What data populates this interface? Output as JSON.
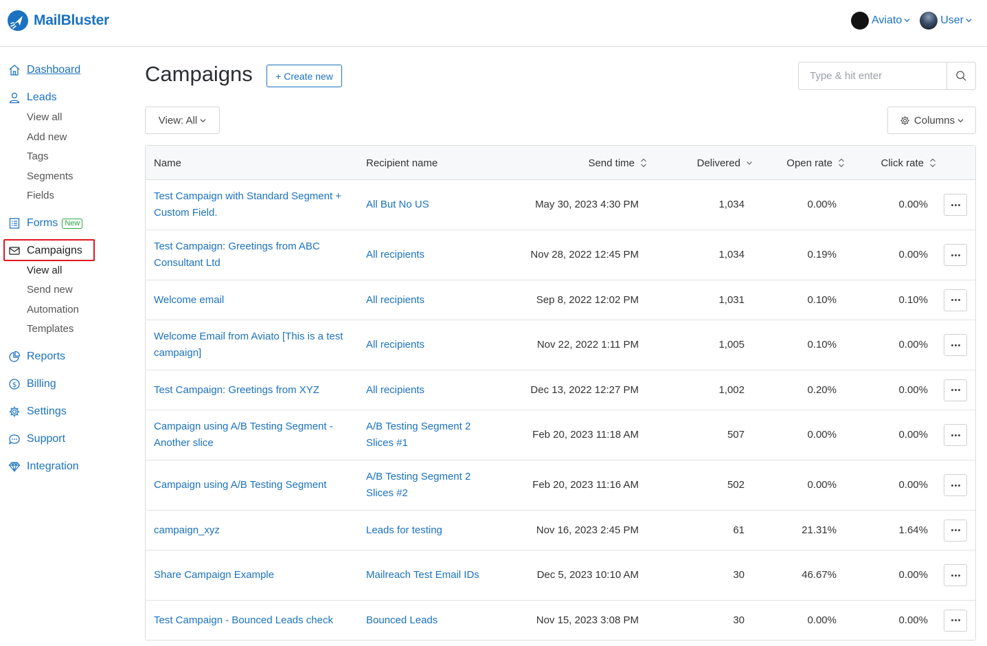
{
  "app": {
    "brand": "MailBluster",
    "brand_color": "#1b72c0"
  },
  "header": {
    "accounts": [
      {
        "label": "Aviato",
        "icon": "aviato-logo"
      },
      {
        "label": "User",
        "icon": "user-avatar"
      }
    ]
  },
  "sidebar": {
    "dashboard": "Dashboard",
    "leads": "Leads",
    "leads_sub": [
      "View all",
      "Add new",
      "Tags",
      "Segments",
      "Fields"
    ],
    "forms": "Forms",
    "forms_badge": "New",
    "campaigns": "Campaigns",
    "campaigns_sub": [
      "View all",
      "Send new",
      "Automation",
      "Templates"
    ],
    "reports": "Reports",
    "billing": "Billing",
    "settings": "Settings",
    "support": "Support",
    "integration": "Integration"
  },
  "main": {
    "title": "Campaigns",
    "create_label": "+ Create new",
    "search_placeholder": "Type & hit enter",
    "view_label": "View: All",
    "columns_label": "Columns"
  },
  "table": {
    "headers": {
      "name": "Name",
      "recipient": "Recipient name",
      "send_time": "Send time",
      "delivered": "Delivered",
      "open_rate": "Open rate",
      "click_rate": "Click rate"
    },
    "rows": [
      {
        "name": "Test Campaign with Standard Segment + Custom Field.",
        "recipient": "All But No US",
        "send_time": "May 30, 2023 4:30 PM",
        "delivered": "1,034",
        "open_rate": "0.00%",
        "click_rate": "0.00%"
      },
      {
        "name": "Test Campaign: Greetings from ABC Consultant Ltd",
        "recipient": "All recipients",
        "send_time": "Nov 28, 2022 12:45 PM",
        "delivered": "1,034",
        "open_rate": "0.19%",
        "click_rate": "0.00%"
      },
      {
        "name": "Welcome email",
        "recipient": "All recipients",
        "send_time": "Sep 8, 2022 12:02 PM",
        "delivered": "1,031",
        "open_rate": "0.10%",
        "click_rate": "0.10%"
      },
      {
        "name": "Welcome Email from Aviato [This is a test campaign]",
        "recipient": "All recipients",
        "send_time": "Nov 22, 2022 1:11 PM",
        "delivered": "1,005",
        "open_rate": "0.10%",
        "click_rate": "0.00%"
      },
      {
        "name": "Test Campaign: Greetings from XYZ",
        "recipient": "All recipients",
        "send_time": "Dec 13, 2022 12:27 PM",
        "delivered": "1,002",
        "open_rate": "0.20%",
        "click_rate": "0.00%"
      },
      {
        "name": "Campaign using A/B Testing Segment - Another slice",
        "recipient": "A/B Testing Segment 2 Slices #1",
        "send_time": "Feb 20, 2023 11:18 AM",
        "delivered": "507",
        "open_rate": "0.00%",
        "click_rate": "0.00%"
      },
      {
        "name": "Campaign using A/B Testing Segment",
        "recipient": "A/B Testing Segment 2 Slices #2",
        "send_time": "Feb 20, 2023 11:16 AM",
        "delivered": "502",
        "open_rate": "0.00%",
        "click_rate": "0.00%"
      },
      {
        "name": "campaign_xyz",
        "recipient": "Leads for testing",
        "send_time": "Nov 16, 2023 2:45 PM",
        "delivered": "61",
        "open_rate": "21.31%",
        "click_rate": "1.64%"
      },
      {
        "name": "Share Campaign Example",
        "recipient": "Mailreach Test Email IDs",
        "send_time": "Dec 5, 2023 10:10 AM",
        "delivered": "30",
        "open_rate": "46.67%",
        "click_rate": "0.00%"
      },
      {
        "name": "Test Campaign - Bounced Leads check",
        "recipient": "Bounced Leads",
        "send_time": "Nov 15, 2023 3:08 PM",
        "delivered": "30",
        "open_rate": "0.00%",
        "click_rate": "0.00%"
      }
    ]
  }
}
